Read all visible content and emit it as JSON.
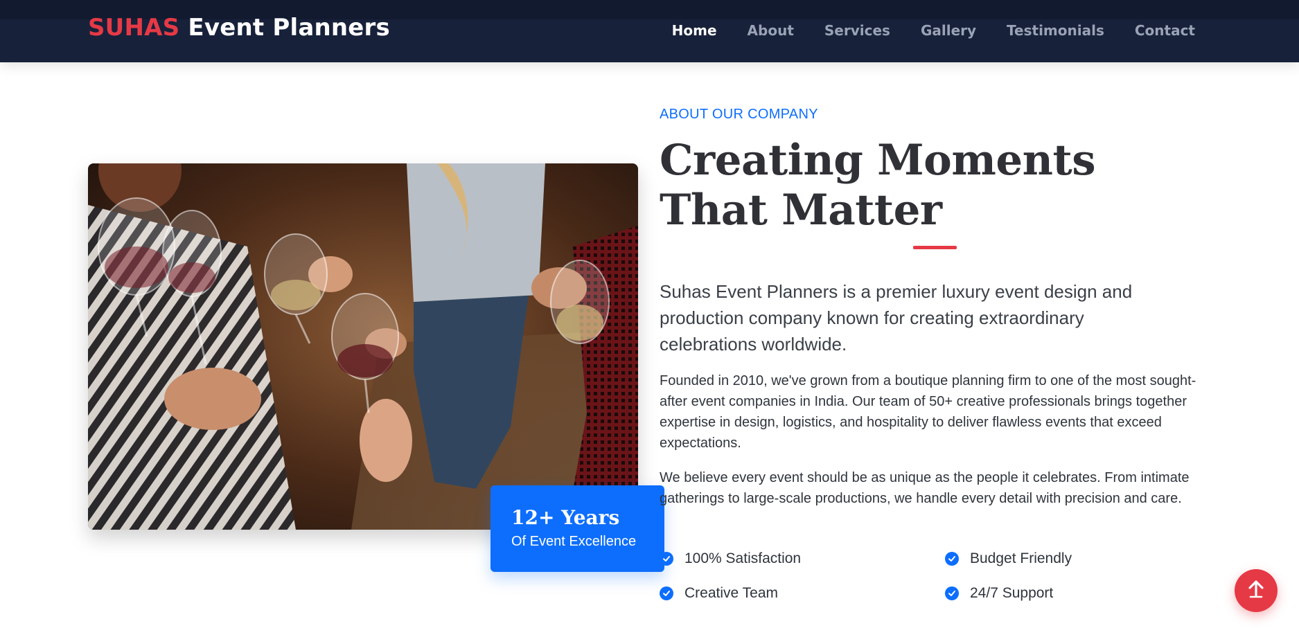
{
  "navbar": {
    "brand_first": "SUHAS",
    "brand_rest": "Event Planners",
    "links": [
      "Home",
      "About",
      "Services",
      "Gallery",
      "Testimonials",
      "Contact"
    ],
    "active": "Home"
  },
  "about": {
    "eyebrow": "ABOUT OUR COMPANY",
    "headline": "Creating Moments That Matter",
    "lead": "Suhas Event Planners is a premier luxury event design and production company known for creating extraordinary celebrations worldwide.",
    "para1": "Founded in 2010, we've grown from a boutique planning firm to one of the most sought-after event companies in India. Our team of 50+ creative professionals brings together expertise in design, logistics, and hospitality to deliver flawless events that exceed expectations.",
    "para2": "We believe every event should be as unique as the people it celebrates. From intimate gatherings to large-scale productions, we handle every detail with precision and care.",
    "features": [
      "100% Satisfaction",
      "Budget Friendly",
      "Creative Team",
      "24/7 Support"
    ]
  },
  "badge": {
    "title": "12+ Years",
    "subtitle": "Of Event Excellence"
  },
  "photo": {
    "subject": "friends toasting wine glasses"
  },
  "colors": {
    "navbar_bg": "#17213a",
    "brand_red": "#e63946",
    "accent_blue": "#0d6efd",
    "heading": "#2f3136"
  },
  "icons": {
    "check": "check-circle-icon",
    "scroll_top": "arrow-up-icon"
  }
}
